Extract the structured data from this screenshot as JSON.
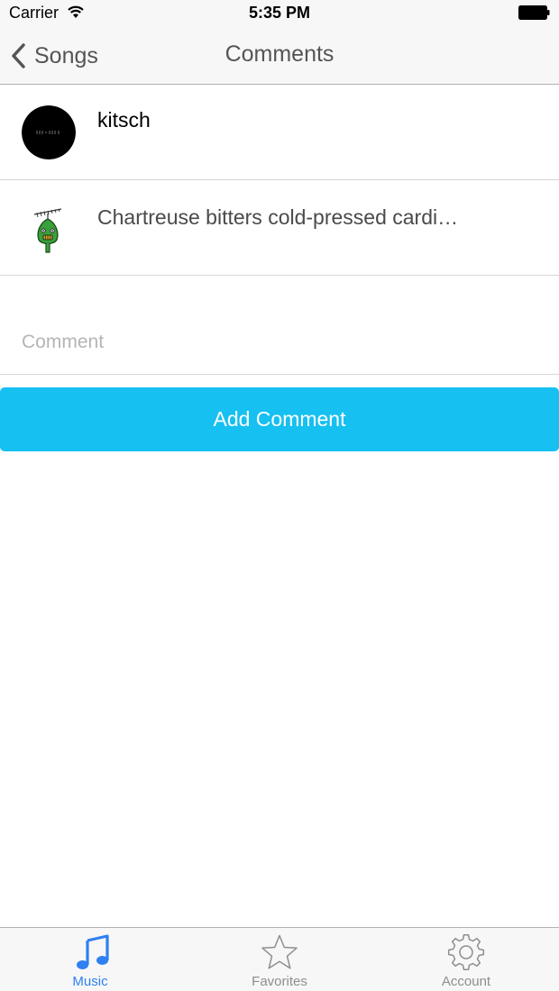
{
  "status_bar": {
    "carrier": "Carrier",
    "time": "5:35 PM"
  },
  "nav": {
    "back_label": "Songs",
    "title": "Comments"
  },
  "comments": [
    {
      "text": "kitsch",
      "avatar_icon": "black-circle-avatar-icon"
    },
    {
      "text": "Chartreuse bitters cold-pressed cardi…",
      "avatar_icon": "green-monster-avatar-icon"
    }
  ],
  "comment_field": {
    "placeholder": "Comment",
    "value": ""
  },
  "add_comment_button": {
    "label": "Add Comment",
    "color": "#16c0f1"
  },
  "tab_bar": {
    "tabs": [
      {
        "label": "Music",
        "icon": "music-note-icon",
        "selected": true,
        "color": "#2f80f1"
      },
      {
        "label": "Favorites",
        "icon": "star-icon",
        "selected": false,
        "color": "#8e8e8e"
      },
      {
        "label": "Account",
        "icon": "gear-icon",
        "selected": false,
        "color": "#8e8e8e"
      }
    ]
  }
}
